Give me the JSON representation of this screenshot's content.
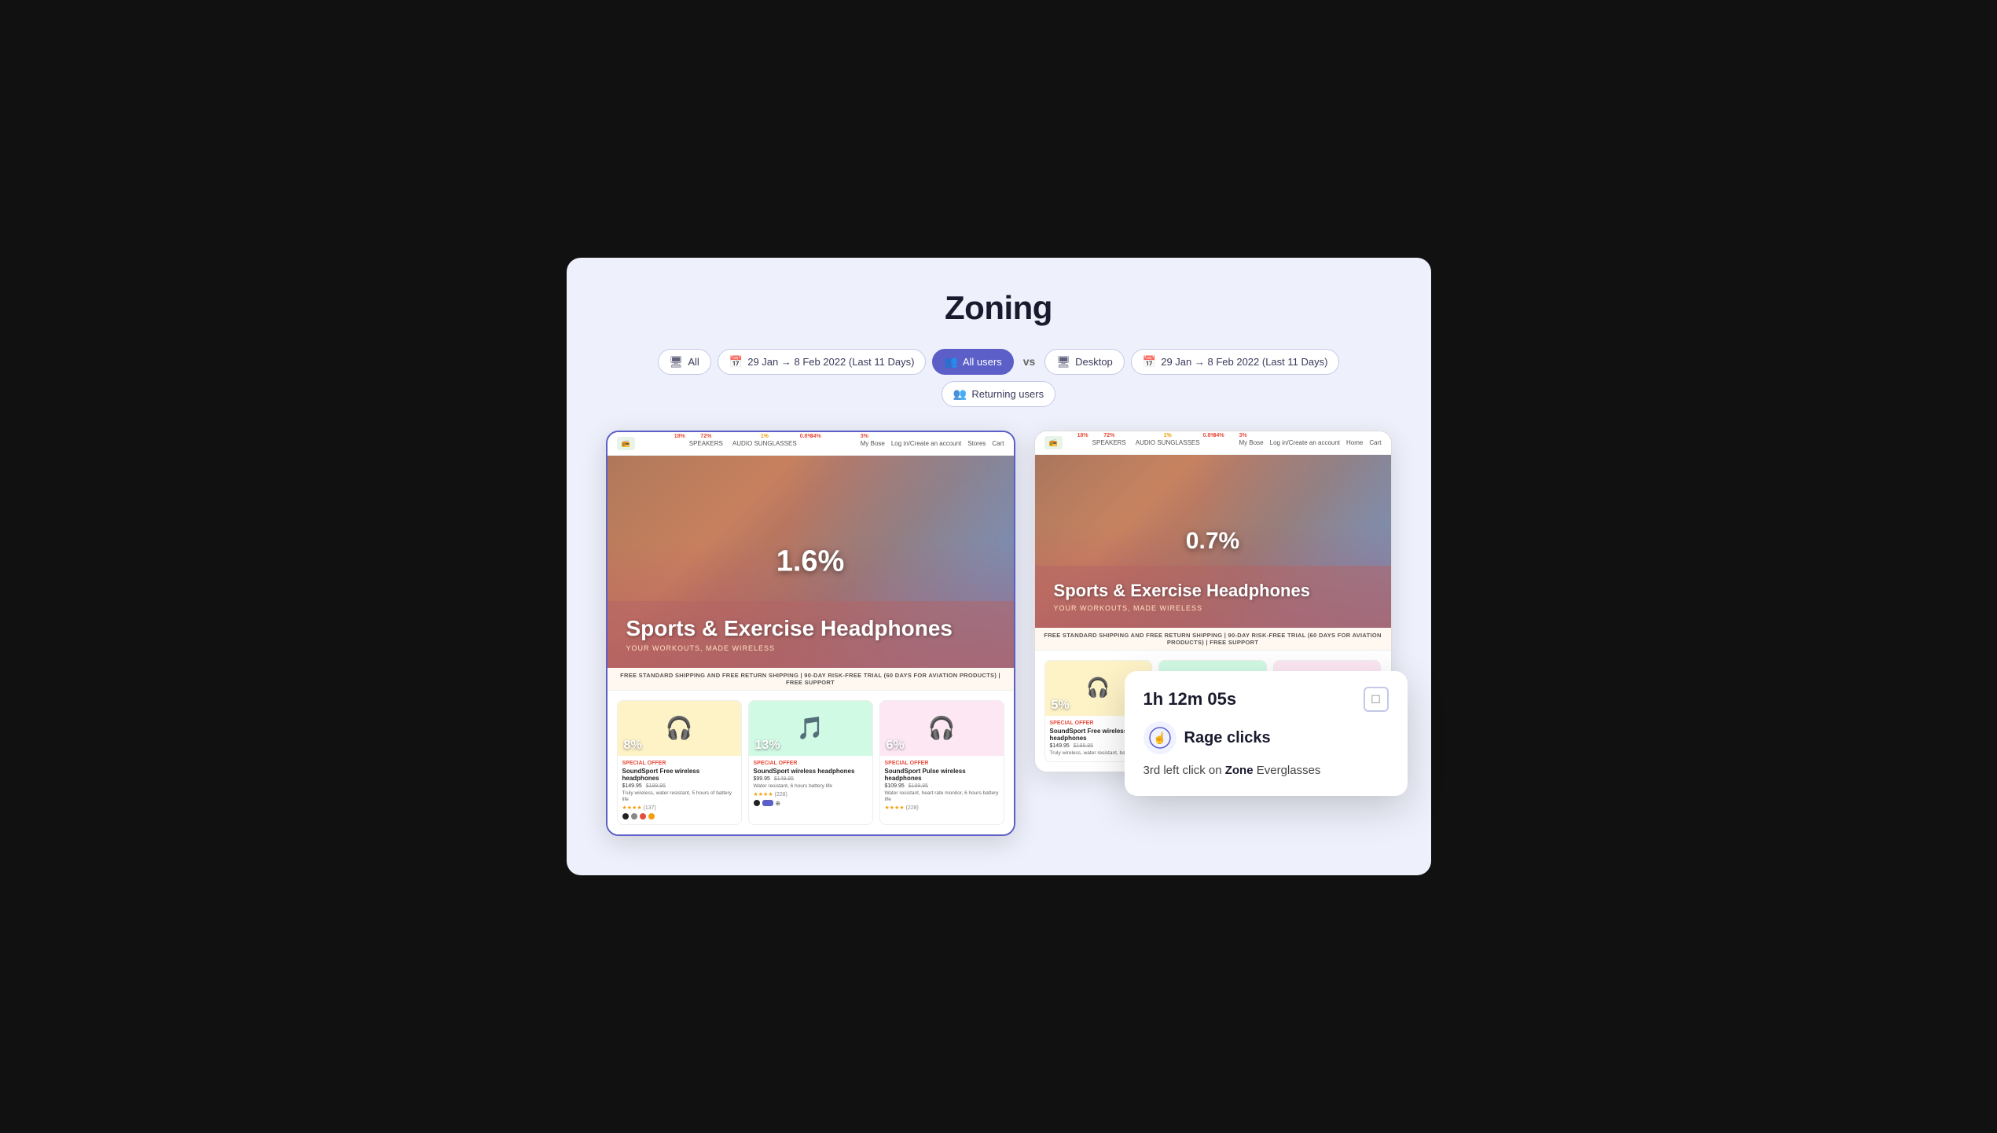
{
  "page": {
    "title": "Zoning",
    "background": "#eef0fb"
  },
  "filter_bar": {
    "left_group": [
      {
        "id": "device-all",
        "icon": "🖥",
        "label": "All",
        "active": false
      },
      {
        "id": "date-left",
        "icon": "📅",
        "label": "29 Jan → 8 Feb 2022 (Last 11 Days)",
        "active": false
      },
      {
        "id": "users-left",
        "icon": "👥",
        "label": "All users",
        "active": true
      }
    ],
    "vs_label": "vs",
    "right_group": [
      {
        "id": "device-desktop",
        "icon": "🖥",
        "label": "Desktop",
        "active": false
      },
      {
        "id": "date-right",
        "icon": "📅",
        "label": "29 Jan → 8 Feb 2022 (Last 11 Days)",
        "active": false
      },
      {
        "id": "users-right",
        "icon": "👥",
        "label": "Returning users",
        "active": false
      }
    ]
  },
  "left_screen": {
    "logo": "📻",
    "nav_items": [
      "18%",
      "72%",
      "AUDIO SUNGLASSES",
      "1%",
      "0.8%",
      "34%"
    ],
    "hero_pct": "1.6%",
    "hero_title": "Sports & Exercise Headphones",
    "hero_subtitle": "YOUR WORKOUTS, MADE WIRELESS",
    "shipping_text": "FREE STANDARD SHIPPING AND FREE RETURN SHIPPING | 90-DAY RISK-FREE TRIAL (60 DAYS FOR AVIATION PRODUCTS) | FREE SUPPORT",
    "products": [
      {
        "label": "SPECIAL OFFER",
        "name": "SoundSport Free wireless headphones",
        "price": "$149.95",
        "original_price": "$199.95",
        "desc": "Truly wireless, water resistant, 5 hours of battery life",
        "pct": "8%",
        "bg": "yellow",
        "icon": "🎧",
        "stars": "★★★★",
        "review_count": "(137)"
      },
      {
        "label": "SPECIAL OFFER",
        "name": "SoundSport wireless headphones",
        "price": "$99.95",
        "original_price": "$149.95",
        "desc": "Water resistant, 6 hours battery life",
        "pct": "13%",
        "bg": "mint",
        "icon": "🎵",
        "stars": "★★★★",
        "review_count": "(228)"
      },
      {
        "label": "SPECIAL OFFER",
        "name": "SoundSport Pulse wireless headphones",
        "price": "$109.95",
        "original_price": "$189.95",
        "desc": "Water resistant, heart rate monitor, 6 hours battery life",
        "pct": "6%",
        "bg": "pink",
        "icon": "🎧",
        "stars": "★★★★",
        "review_count": "(228)"
      }
    ]
  },
  "right_screen": {
    "logo": "📻",
    "hero_pct": "0.7%",
    "hero_title": "Sports & Exercise Headphones",
    "hero_subtitle": "YOUR WORKOUTS, MADE WIRELESS",
    "shipping_text": "FREE STANDARD SHIPPING AND FREE RETURN SHIPPING | 90-DAY RISK-FREE TRIAL (60 DAYS FOR AVIATION PRODUCTS) | FREE SUPPORT",
    "products": [
      {
        "pct": "5%",
        "bg": "yellow",
        "icon": "🎧",
        "name": "SoundSport Free wireless headphones",
        "label": "SPECIAL OFFER",
        "price": "$149.95",
        "original_price": "$199.95"
      },
      {
        "pct": "",
        "bg": "mint",
        "icon": "🌿"
      },
      {
        "pct": "",
        "bg": "pink",
        "icon": "🎧"
      }
    ]
  },
  "tooltip": {
    "time": "1h 12m 05s",
    "icon_label": "□",
    "rage_label": "Rage clicks",
    "rage_icon": "😤",
    "description_pre": "3rd left click on ",
    "description_bold": "Zone",
    "description_post": " Everglasses"
  }
}
